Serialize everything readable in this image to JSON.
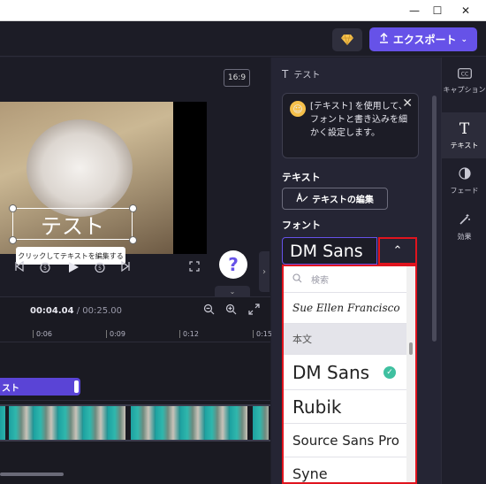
{
  "window": {
    "minimize": "—",
    "maximize": "☐",
    "close": "✕"
  },
  "header": {
    "premium_icon": "diamond-icon",
    "export_label": "エクスポート",
    "export_icon": "upload-icon"
  },
  "preview": {
    "aspect_ratio": "16:9",
    "overlay_text": "テスト",
    "tooltip": "クリックしてテキストを編集する"
  },
  "playback": {
    "help": "?"
  },
  "timeline": {
    "current_time": "00:04.04",
    "total_time": "/ 00:25.00",
    "ticks": [
      "0:06",
      "0:09",
      "0:12",
      "0:15"
    ],
    "text_clip_label": "スト"
  },
  "panel": {
    "title": "テスト",
    "info_text": "[テキスト] を使用して、フォントと書き込みを細かく設定します。",
    "text_section": "テキスト",
    "edit_button": "テキストの編集",
    "font_section": "フォント",
    "font_selected": "DM Sans"
  },
  "font_dropdown": {
    "search_placeholder": "検索",
    "items": [
      {
        "label": "Sue Ellen Francisco"
      },
      {
        "label": "本文"
      },
      {
        "label": "DM Sans",
        "selected": true
      },
      {
        "label": "Rubik"
      },
      {
        "label": "Source Sans Pro"
      },
      {
        "label": "Syne"
      }
    ]
  },
  "rail": {
    "items": [
      {
        "label": "キャプション",
        "icon": "cc-icon"
      },
      {
        "label": "テキスト",
        "icon": "text-icon",
        "active": true
      },
      {
        "label": "フェード",
        "icon": "fade-icon"
      },
      {
        "label": "効果",
        "icon": "magic-wand-icon"
      }
    ]
  },
  "colors": {
    "accent": "#6652e8",
    "highlight": "#e0141e",
    "check": "#3fc0a0"
  }
}
